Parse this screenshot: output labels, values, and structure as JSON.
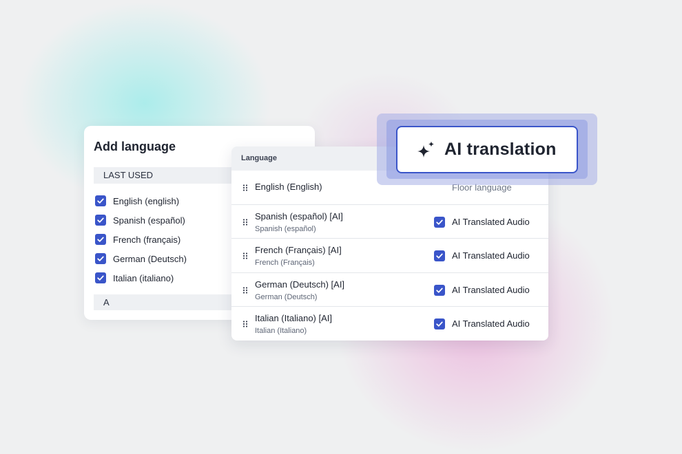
{
  "add_language": {
    "title": "Add language",
    "last_used_label": "LAST USED",
    "items": [
      {
        "label": "English (english)",
        "checked": true
      },
      {
        "label": "Spanish (español)",
        "checked": true
      },
      {
        "label": "French (français)",
        "checked": true
      },
      {
        "label": "German (Deutsch)",
        "checked": true
      },
      {
        "label": "Italian (italiano)",
        "checked": true
      }
    ],
    "alpha_section_label": "A"
  },
  "language_table": {
    "header": "Language",
    "rows": [
      {
        "name": "English (English)",
        "status": "Floor language"
      },
      {
        "name": "Spanish (español) [AI]",
        "sub": "Spanish (español)",
        "status": "AI Translated Audio",
        "checked": true
      },
      {
        "name": "French (Français) [AI]",
        "sub": "French (Français)",
        "status": "AI Translated Audio",
        "checked": true
      },
      {
        "name": "German (Deutsch) [AI]",
        "sub": "German (Deutsch)",
        "status": "AI Translated Audio",
        "checked": true
      },
      {
        "name": "Italian (Italiano) [AI]",
        "sub": "Italian (Italiano)",
        "status": "AI Translated Audio",
        "checked": true
      }
    ]
  },
  "ai_badge": {
    "label": "AI translation",
    "icon": "sparkle-icon"
  },
  "colors": {
    "accent": "#3a55c9",
    "background": "#eff0f1"
  }
}
